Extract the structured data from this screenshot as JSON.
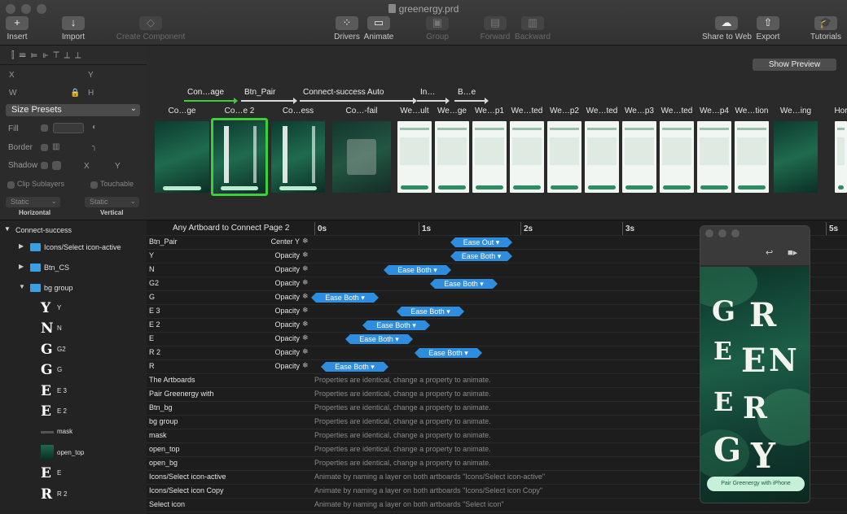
{
  "window": {
    "title": "greenergy.prd"
  },
  "toolbar": {
    "insert": "Insert",
    "import": "Import",
    "create_component": "Create Component",
    "drivers": "Drivers",
    "animate": "Animate",
    "group": "Group",
    "forward": "Forward",
    "backward": "Backward",
    "share_to_web": "Share to Web",
    "export": "Export",
    "tutorials": "Tutorials"
  },
  "props": {
    "x": "X",
    "y": "Y",
    "w": "W",
    "h": "H",
    "size_presets": "Size Presets",
    "fill": "Fill",
    "border": "Border",
    "shadow": "Shadow",
    "shadow_x": "X",
    "shadow_y": "Y",
    "clip_sublayers": "Clip Sublayers",
    "touchable": "Touchable",
    "horizontal_value": "Static",
    "vertical_value": "Static",
    "horizontal": "Horizontal",
    "vertical": "Vertical"
  },
  "layers": {
    "root": "Connect-success",
    "items": [
      {
        "name": "Icons/Select icon-active",
        "kind": "folder"
      },
      {
        "name": "Btn_CS",
        "kind": "folder"
      },
      {
        "name": "bg group",
        "kind": "folder"
      },
      {
        "name": "Y",
        "kind": "glyph",
        "glyph": "Y"
      },
      {
        "name": "N",
        "kind": "glyph",
        "glyph": "N"
      },
      {
        "name": "G2",
        "kind": "glyph",
        "glyph": "G"
      },
      {
        "name": "G",
        "kind": "glyph",
        "glyph": "G"
      },
      {
        "name": "E 3",
        "kind": "glyph",
        "glyph": "E"
      },
      {
        "name": "E 2",
        "kind": "glyph",
        "glyph": "E"
      },
      {
        "name": "mask",
        "kind": "mask"
      },
      {
        "name": "open_top",
        "kind": "image"
      },
      {
        "name": "E",
        "kind": "glyph",
        "glyph": "E"
      },
      {
        "name": "R 2",
        "kind": "glyph",
        "glyph": "R"
      }
    ]
  },
  "strip": {
    "show_preview": "Show Preview",
    "links": [
      "Con…age",
      "Btn_Pair",
      "Connect-success Auto",
      "In…",
      "B…e"
    ],
    "artboards": [
      "Co…ge",
      "Co…e 2",
      "Co…ess",
      "Co…-fail",
      "We…ult",
      "We…ge",
      "We…p1",
      "We…ted",
      "We…p2",
      "We…ted",
      "We…p3",
      "We…ted",
      "We…p4",
      "We…tion",
      "We…ing",
      "Hor"
    ]
  },
  "timeline": {
    "header": "Any Artboard to Connect Page 2",
    "ticks": [
      "0s",
      "1s",
      "2s",
      "3s",
      "5s"
    ],
    "rows": [
      {
        "name": "Btn_Pair",
        "prop": "Center Y",
        "ease": "Ease Out ▾",
        "start": 1.3,
        "dur": 0.6
      },
      {
        "name": "Y",
        "prop": "Opacity",
        "ease": "Ease Both ▾",
        "start": 1.3,
        "dur": 0.6
      },
      {
        "name": "N",
        "prop": "Opacity",
        "ease": "Ease Both ▾",
        "start": 0.65,
        "dur": 0.65
      },
      {
        "name": "G2",
        "prop": "Opacity",
        "ease": "Ease Both ▾",
        "start": 1.1,
        "dur": 0.65
      },
      {
        "name": "G",
        "prop": "Opacity",
        "ease": "Ease Both ▾",
        "start": -0.05,
        "dur": 0.65
      },
      {
        "name": "E 3",
        "prop": "Opacity",
        "ease": "Ease Both ▾",
        "start": 0.78,
        "dur": 0.65
      },
      {
        "name": "E 2",
        "prop": "Opacity",
        "ease": "Ease Both ▾",
        "start": 0.45,
        "dur": 0.65
      },
      {
        "name": "E",
        "prop": "Opacity",
        "ease": "Ease Both ▾",
        "start": 0.28,
        "dur": 0.65
      },
      {
        "name": "R 2",
        "prop": "Opacity",
        "ease": "Ease Both ▾",
        "start": 0.95,
        "dur": 0.65
      },
      {
        "name": "R",
        "prop": "Opacity",
        "ease": "Ease Both ▾",
        "start": 0.05,
        "dur": 0.65
      },
      {
        "name": "The Artboards",
        "text": "Properties are identical, change a property to animate."
      },
      {
        "name": "Pair Greenergy with",
        "text": "Properties are identical, change a property to animate."
      },
      {
        "name": "Btn_bg",
        "text": "Properties are identical, change a property to animate."
      },
      {
        "name": "bg group",
        "text": "Properties are identical, change a property to animate."
      },
      {
        "name": "mask",
        "text": "Properties are identical, change a property to animate."
      },
      {
        "name": "open_top",
        "text": "Properties are identical, change a property to animate."
      },
      {
        "name": "open_bg",
        "text": "Properties are identical, change a property to animate."
      },
      {
        "name": "Icons/Select icon-active",
        "text": "Animate by naming a layer on both artboards \"Icons/Select icon-active\""
      },
      {
        "name": "Icons/Select icon Copy",
        "text": "Animate by naming a layer on both artboards \"Icons/Select icon Copy\""
      },
      {
        "name": "Select icon",
        "text": "Animate by naming a layer on both artboards \"Select icon\""
      }
    ]
  },
  "preview": {
    "letters": "GREENERGY",
    "button": "Pair Greenergy with iPhone"
  },
  "colors": {
    "accent": "#2f8de0",
    "selection": "#3ccf3c",
    "brand_green": "#1f6b4e",
    "folder": "#3aa0e6"
  }
}
